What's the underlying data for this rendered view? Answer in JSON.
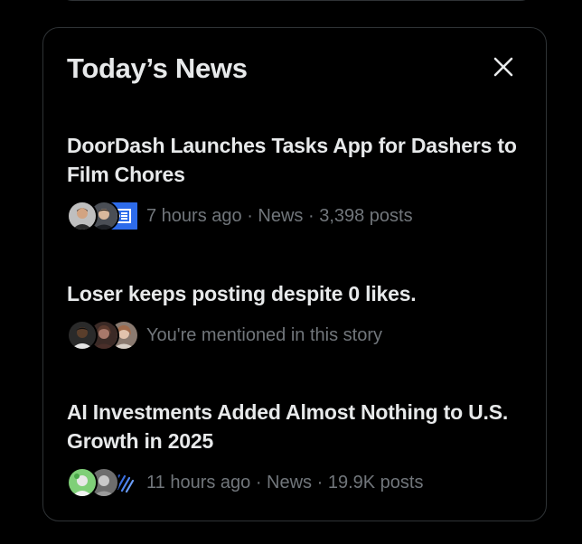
{
  "widget": {
    "title": "Today’s News",
    "close_label": "Close"
  },
  "stories": [
    {
      "headline": "DoorDash Launches Tasks App for Dashers to Film Chores",
      "meta": "7 hours ago · News · 3,398 posts",
      "avatars": [
        "person-avatar",
        "person-avatar",
        "doordash-logo"
      ]
    },
    {
      "headline": "Loser keeps posting despite 0 likes.",
      "meta": "You're mentioned in this story",
      "avatars": [
        "person-avatar",
        "person-avatar",
        "person-avatar"
      ]
    },
    {
      "headline": "AI Investments Added Almost Nothing to U.S. Growth in 2025",
      "meta": "11 hours ago · News · 19.9K posts",
      "avatars": [
        "person-avatar",
        "person-avatar",
        "stripes-logo"
      ]
    }
  ],
  "colors": {
    "background": "#000000",
    "border": "#2f3336",
    "primary_text": "#e7e9ea",
    "secondary_text": "#71767b",
    "doordash_blue": "#2d6bea"
  }
}
